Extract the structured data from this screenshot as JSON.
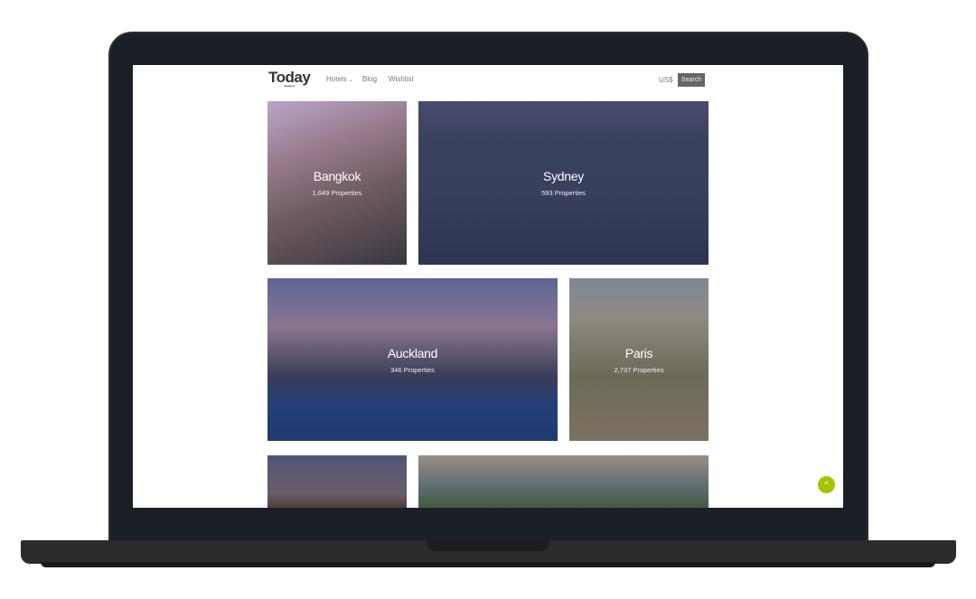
{
  "nav": {
    "logo": "Today",
    "logo_tagline": "travel agency",
    "links": [
      "Hotels",
      "Blog",
      "Wishlist"
    ],
    "hotels_caret": "⌄",
    "currency": "US$",
    "search_label": "Search"
  },
  "destinations": [
    {
      "name": "Bangkok",
      "count": "1,649 Properties"
    },
    {
      "name": "Sydney",
      "count": "593 Properties"
    },
    {
      "name": "Auckland",
      "count": "346 Properties"
    },
    {
      "name": "Paris",
      "count": "2,737 Properties"
    }
  ],
  "scroll_top_icon": "^"
}
